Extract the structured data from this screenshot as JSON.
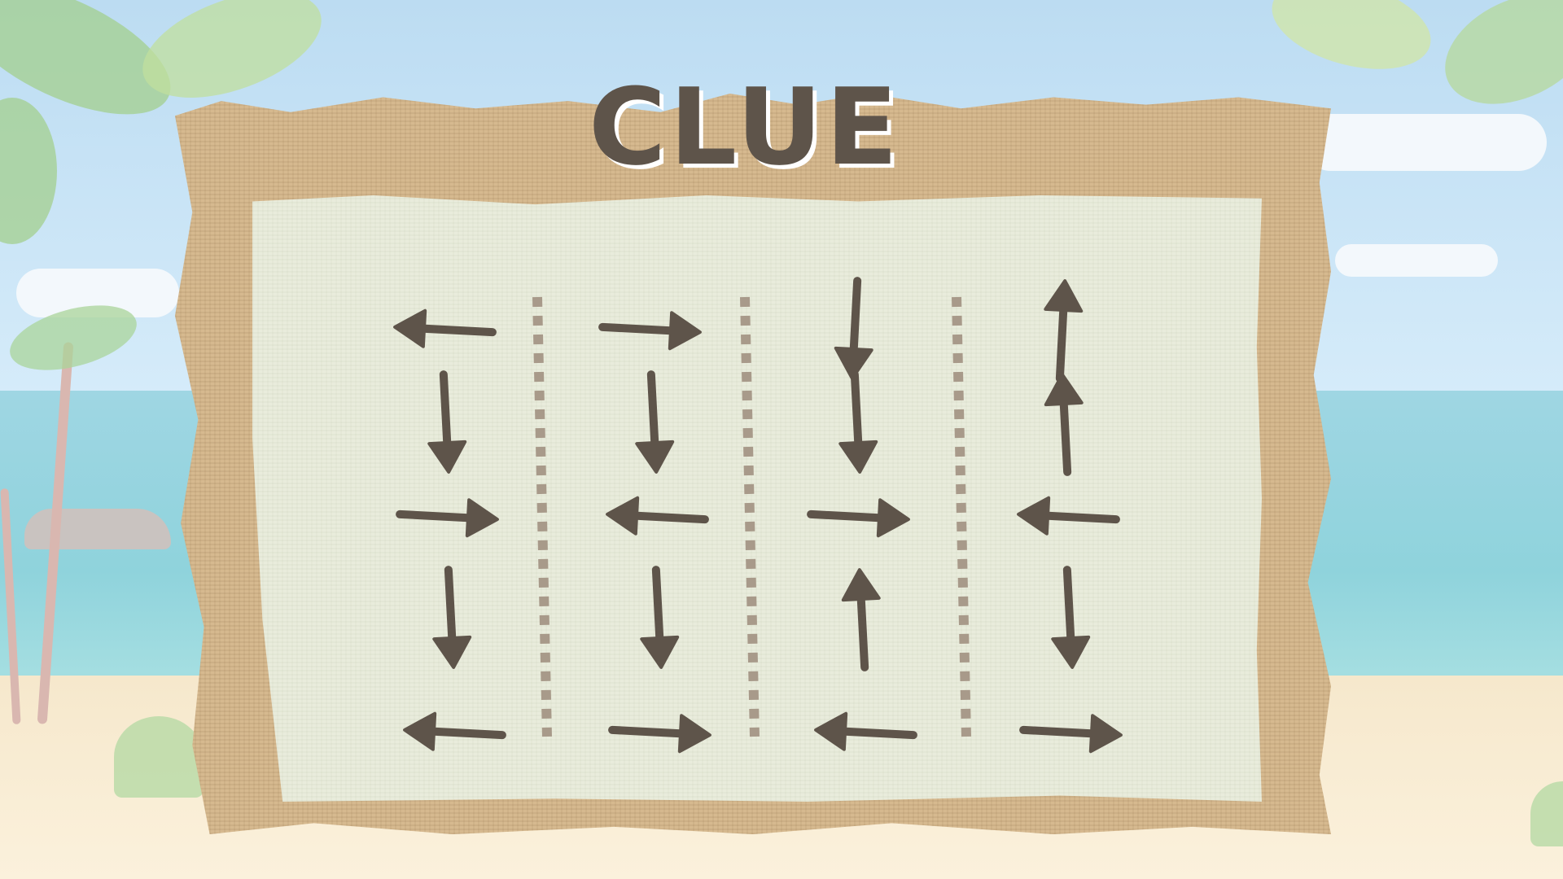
{
  "title": "CLUE",
  "colors": {
    "arrow": "#5e544a",
    "divider": "#a89a8a",
    "title": "#5e544a",
    "cardboard": "#d6b98f",
    "paper": "#e9ecdc"
  },
  "columns": [
    {
      "arrows": [
        "left",
        "down",
        "right",
        "down",
        "left"
      ]
    },
    {
      "arrows": [
        "right",
        "down",
        "left",
        "down",
        "right"
      ]
    },
    {
      "arrows": [
        "down",
        "down",
        "right",
        "up",
        "left"
      ]
    },
    {
      "arrows": [
        "up",
        "up",
        "left",
        "down",
        "right"
      ]
    }
  ]
}
